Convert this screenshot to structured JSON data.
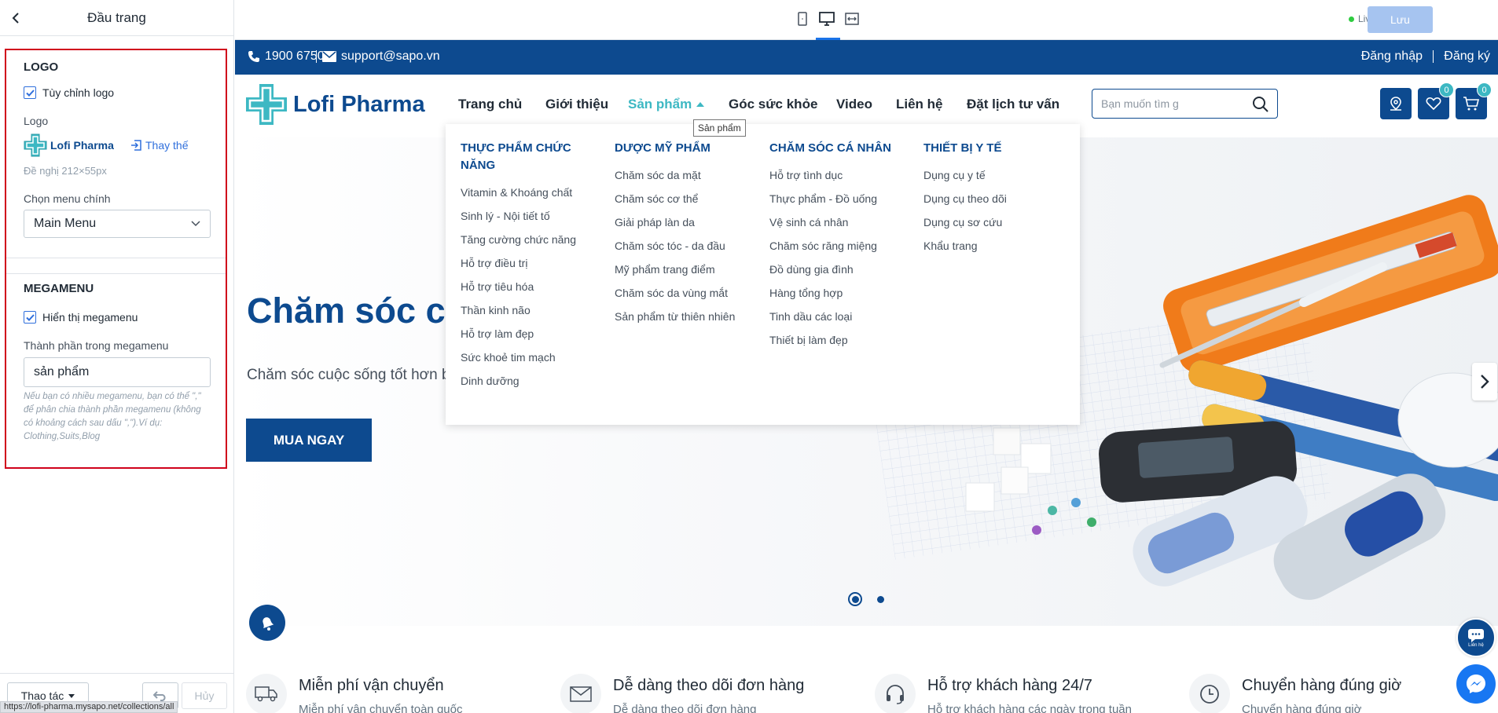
{
  "sidebar": {
    "title": "Đầu trang",
    "logo_section": {
      "title": "LOGO",
      "custom_logo_label": "Tùy chỉnh logo",
      "logo_label": "Logo",
      "replace_label": "Thay thế",
      "suggestion": "Đề nghị 212×55px",
      "menu_label": "Chọn menu chính",
      "menu_value": "Main Menu"
    },
    "mega_section": {
      "title": "MEGAMENU",
      "show_label": "Hiển thị megamenu",
      "components_label": "Thành phần trong megamenu",
      "components_value": "sản phẩm",
      "hint": "Nếu bạn có nhiều megamenu, bạn có thể \",\" để phân chia thành phần megamenu (không có khoảng cách sau dấu \",\").Ví dụ: Clothing,Suits,Blog"
    },
    "footer": {
      "actions_label": "Thao tác",
      "cancel_label": "Hủy"
    },
    "status_url": "https://lofi-pharma.mysapo.net/collections/all"
  },
  "topbar": {
    "live_label": "Live",
    "save_label": "Lưu"
  },
  "preview": {
    "phone": "1900 6750",
    "email": "support@sapo.vn",
    "login": "Đăng nhập",
    "register": "Đăng ký",
    "brand": "Lofi Pharma",
    "nav": [
      "Trang chủ",
      "Giới thiệu",
      "Sản phẩm",
      "Góc sức khỏe",
      "Video",
      "Liên hệ",
      "Đặt lịch tư vấn"
    ],
    "search_placeholder": "Bạn muốn tìm g",
    "wishlist_count": "0",
    "cart_count": "0",
    "tooltip": "Sản phẩm",
    "mega": [
      {
        "title": "THỰC PHẨM CHỨC NĂNG",
        "items": [
          "Vitamin & Khoáng chất",
          "Sinh lý - Nội tiết tố",
          "Tăng cường chức năng",
          "Hỗ trợ điều trị",
          "Hỗ trợ tiêu hóa",
          "Thần kinh não",
          "Hỗ trợ làm đẹp",
          "Sức khoẻ tim mạch",
          "Dinh dưỡng"
        ]
      },
      {
        "title": "DƯỢC MỸ PHẨM",
        "items": [
          "Chăm sóc da mặt",
          "Chăm sóc cơ thể",
          "Giải pháp làn da",
          "Chăm sóc tóc - da đầu",
          "Mỹ phẩm trang điểm",
          "Chăm sóc da vùng mắt",
          "Sản phẩm từ thiên nhiên"
        ]
      },
      {
        "title": "CHĂM SÓC CÁ NHÂN",
        "items": [
          "Hỗ trợ tình dục",
          "Thực phẩm - Đồ uống",
          "Vệ sinh cá nhân",
          "Chăm sóc răng miệng",
          "Đồ dùng gia đình",
          "Hàng tổng hợp",
          "Tinh dầu các loại",
          "Thiết bị làm đẹp"
        ]
      },
      {
        "title": "THIẾT BỊ Y TẾ",
        "items": [
          "Dụng cụ y tế",
          "Dụng cụ theo dõi",
          "Dụng cụ sơ cứu",
          "Khẩu trang"
        ]
      }
    ],
    "hero_title": "Chăm sóc cu",
    "hero_sub": "Chăm sóc cuộc sống tốt hơn b",
    "hero_button": "MUA NGAY",
    "chat_label": "Liên hệ",
    "features": [
      {
        "title": "Miễn phí vận chuyển",
        "sub": "Miễn phí vận chuyển toàn quốc",
        "icon": "truck-icon"
      },
      {
        "title": "Dễ dàng theo dõi đơn hàng",
        "sub": "Dễ dàng theo dõi đơn hàng",
        "icon": "mail-icon"
      },
      {
        "title": "Hỗ trợ khách hàng 24/7",
        "sub": "Hỗ trợ khách hàng các ngày trong tuần",
        "icon": "headset-icon"
      },
      {
        "title": "Chuyển hàng đúng giờ",
        "sub": "Chuyển hàng đúng giờ",
        "icon": "clock-icon"
      }
    ]
  },
  "colors": {
    "brand": "#0d4a8f",
    "accent": "#3db8c3",
    "highlight_border": "#d0021b",
    "save_button": "#a6c4f0"
  }
}
